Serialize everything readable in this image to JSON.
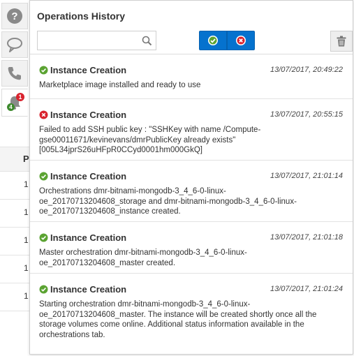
{
  "panel": {
    "title": "Operations History",
    "search": {
      "value": "",
      "placeholder": ""
    },
    "filters": {
      "success_icon": "check-circle-icon",
      "error_icon": "x-circle-icon"
    },
    "delete_icon": "trash-icon"
  },
  "rail": {
    "icons": [
      "help-icon",
      "chat-icon",
      "phone-icon",
      "notifications-icon"
    ],
    "badges": {
      "error_count": "1",
      "success_count": "4"
    }
  },
  "background_table": {
    "header_fragment": "P",
    "row_fragments": [
      "1",
      "1",
      "1",
      "1",
      "1"
    ]
  },
  "entries": [
    {
      "status": "success",
      "title": "Instance Creation",
      "time": "13/07/2017, 20:49:22",
      "message": "Marketplace image installed and ready to use"
    },
    {
      "status": "error",
      "title": "Instance Creation",
      "time": "13/07/2017, 20:55:15",
      "message": "Failed to add SSH public key : \"SSHKey with name /Compute-gse00011671/kevinevans/dmrPublicKey already exists\" [005L34jprS26uHFpR0CCyd0001hm000GkQ]"
    },
    {
      "status": "success",
      "title": "Instance Creation",
      "time": "13/07/2017, 21:01:14",
      "message": "Orchestrations dmr-bitnami-mongodb-3_4_6-0-linux-oe_20170713204608_storage and dmr-bitnami-mongodb-3_4_6-0-linux-oe_20170713204608_instance created."
    },
    {
      "status": "success",
      "title": "Instance Creation",
      "time": "13/07/2017, 21:01:18",
      "message": "Master orchestration dmr-bitnami-mongodb-3_4_6-0-linux-oe_20170713204608_master created."
    },
    {
      "status": "success",
      "title": "Instance Creation",
      "time": "13/07/2017, 21:01:24",
      "message": "Starting orchestration dmr-bitnami-mongodb-3_4_6-0-linux-oe_20170713204608_master. The instance will be created shortly once all the storage volumes come online. Additional status information available in the orchestrations tab."
    }
  ],
  "colors": {
    "accent": "#0572ce",
    "success": "#5ba332",
    "error": "#d9232e"
  }
}
